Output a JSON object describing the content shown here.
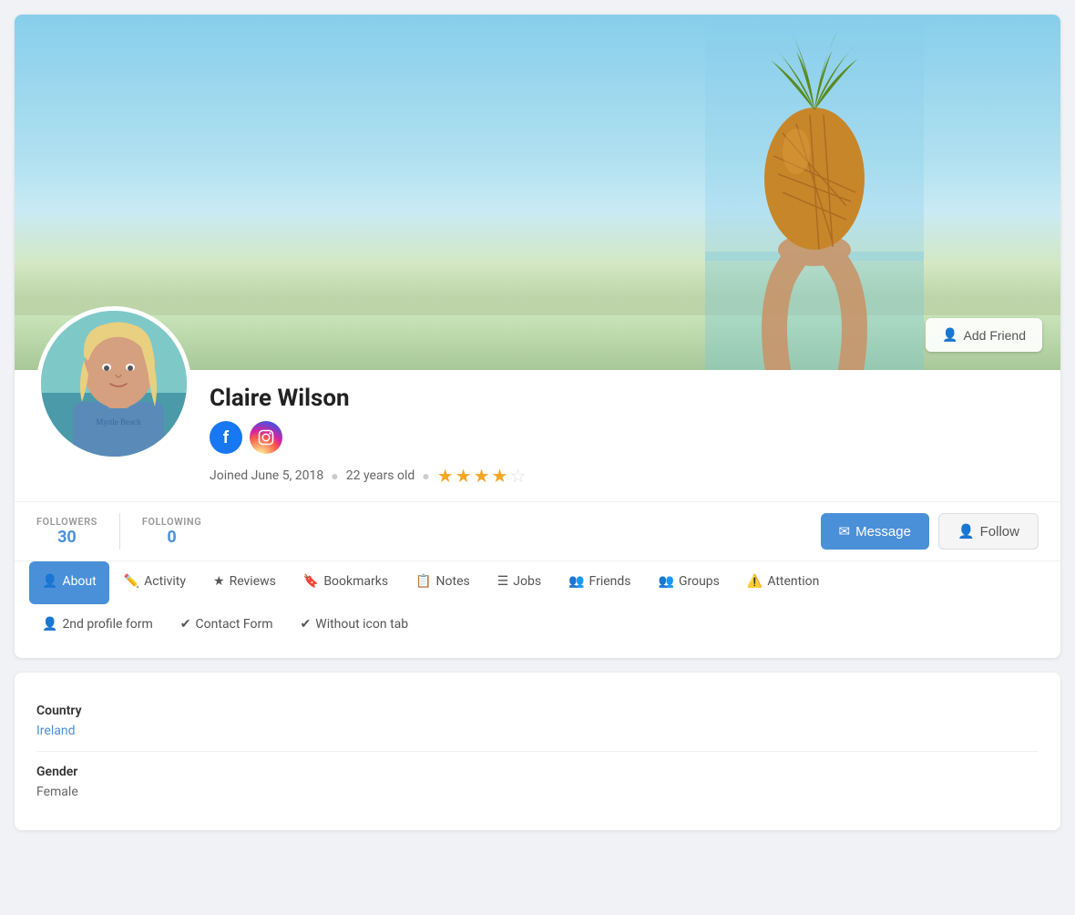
{
  "profile": {
    "name": "Claire Wilson",
    "joined": "Joined June 5, 2018",
    "age": "22 years old",
    "rating": 3.5,
    "followers": 30,
    "following": 0,
    "followers_label": "FOLLOWERS",
    "following_label": "FOLLOWING"
  },
  "buttons": {
    "add_friend": "Add Friend",
    "message": "Message",
    "follow": "Follow"
  },
  "tabs": [
    {
      "id": "about",
      "label": "About",
      "icon": "👤",
      "active": true
    },
    {
      "id": "activity",
      "label": "Activity",
      "icon": "✏️",
      "active": false
    },
    {
      "id": "reviews",
      "label": "Reviews",
      "icon": "⭐",
      "active": false
    },
    {
      "id": "bookmarks",
      "label": "Bookmarks",
      "icon": "🔖",
      "active": false
    },
    {
      "id": "notes",
      "label": "Notes",
      "icon": "📋",
      "active": false
    },
    {
      "id": "jobs",
      "label": "Jobs",
      "icon": "☰",
      "active": false
    },
    {
      "id": "friends",
      "label": "Friends",
      "icon": "👥",
      "active": false
    },
    {
      "id": "groups",
      "label": "Groups",
      "icon": "👥",
      "active": false
    },
    {
      "id": "attention",
      "label": "Attention",
      "icon": "⚠️",
      "active": false
    }
  ],
  "tabs_row2": [
    {
      "id": "2nd-profile",
      "label": "2nd profile form",
      "icon": "👤"
    },
    {
      "id": "contact-form",
      "label": "Contact Form",
      "icon": "✔️"
    },
    {
      "id": "without-icon",
      "label": "Without icon tab",
      "icon": "✔️"
    }
  ],
  "fields": [
    {
      "label": "Country",
      "value": "Ireland"
    },
    {
      "label": "Gender",
      "value": "Female"
    }
  ],
  "social": {
    "facebook_label": "f",
    "instagram_label": "📷"
  }
}
